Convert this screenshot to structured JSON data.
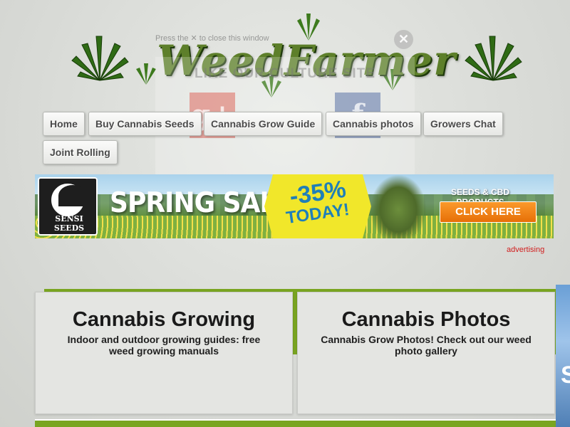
{
  "site": {
    "logo_text": "WeedFarmer"
  },
  "share_popup": {
    "note": "Press the ✕ to close this window",
    "title": "LIKE OUR CULTURE SITE",
    "close_glyph": "✕",
    "google_glyph": "g+",
    "facebook_glyph": "f"
  },
  "nav": {
    "items": [
      {
        "label": "Home"
      },
      {
        "label": "Buy Cannabis Seeds"
      },
      {
        "label": "Cannabis Grow Guide"
      },
      {
        "label": "Cannabis photos"
      },
      {
        "label": "Growers Chat"
      },
      {
        "label": "Joint Rolling"
      }
    ]
  },
  "banner": {
    "brand": "SENSI SEEDS",
    "headline": "SPRING SALE",
    "discount": "-35%",
    "today": "TODAY!",
    "products": "SEEDS & CBD PRODUCTS",
    "cta": "CLICK HERE"
  },
  "advertising_label": "advertising",
  "cards": [
    {
      "title": "Cannabis Growing",
      "description": "Indoor and outdoor growing guides: free weed growing manuals"
    },
    {
      "title": "Cannabis Photos",
      "description": "Cannabis Grow Photos! Check out our weed photo gallery"
    }
  ],
  "side_ad_letter": "S",
  "colors": {
    "nav_text": "#4a4a4a",
    "accent_green": "#79a521",
    "logo_green": "#5d7f2a",
    "advertising_red": "#d11e1e",
    "cta_orange": "#f07d16"
  }
}
